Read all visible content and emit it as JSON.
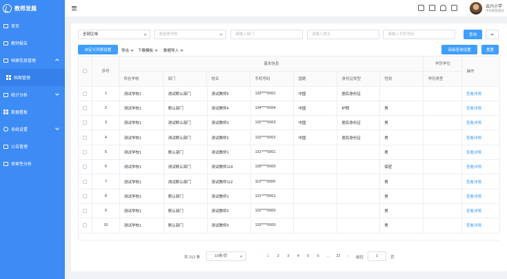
{
  "app": {
    "title": "教师发展"
  },
  "sidebar": {
    "items": [
      {
        "label": "首页"
      },
      {
        "label": "教师报告"
      },
      {
        "label": "档案信息管理"
      },
      {
        "label": "档案管理"
      },
      {
        "label": "统计分析"
      },
      {
        "label": "数据看板"
      },
      {
        "label": "系统设置"
      },
      {
        "label": "公告管理"
      },
      {
        "label": "探索性分析"
      }
    ]
  },
  "header": {
    "user_name": "云兴小学",
    "user_sub": "市校教管理员"
  },
  "filters": {
    "region": "全部区域",
    "school_placeholder": "请选择学校",
    "dept_placeholder": "请输入部门",
    "name_placeholder": "请输入姓名",
    "phone_placeholder": "请输入手机号码",
    "query_label": "查询"
  },
  "toolbar": {
    "custom_cols": "自定义列表设置",
    "export": "导出",
    "download_template": "下载模板",
    "data_import": "数据导入",
    "advanced_query": "高级查询设置",
    "reset": "重置"
  },
  "table": {
    "group_basic": "基本信息",
    "group_edu": "学历学位",
    "col_index": "序号",
    "col_action": "操作",
    "columns": [
      "所在学校",
      "部门",
      "姓名",
      "手机号码",
      "国籍",
      "身份证类型",
      "性别",
      "学历类型"
    ],
    "action_label": "查看详情",
    "rows": [
      {
        "idx": "1",
        "school": "测试学校1",
        "dept": "测试默认部门",
        "name": "测试教师5",
        "phone": "133****0001",
        "nation": "中国",
        "idtype": "居民身份证",
        "gender": ""
      },
      {
        "idx": "2",
        "school": "测试学校1",
        "dept": "默认部门",
        "name": "测试教师4",
        "phone": "134****0004",
        "nation": "中国",
        "idtype": "护照",
        "gender": "男"
      },
      {
        "idx": "3",
        "school": "测试学校1",
        "dept": "测试默认部门",
        "name": "测试教师3",
        "phone": "132****0003",
        "nation": "中国",
        "idtype": "居民身份证",
        "gender": "男"
      },
      {
        "idx": "4",
        "school": "测试学校1",
        "dept": "测试默认部门",
        "name": "测试教师2",
        "phone": "132****0002",
        "nation": "中国",
        "idtype": "居民身份证",
        "gender": "男"
      },
      {
        "idx": "5",
        "school": "测试学校1",
        "dept": "默认部门",
        "name": "测试教师1",
        "phone": "131****0001",
        "nation": "",
        "idtype": "",
        "gender": "男"
      },
      {
        "idx": "6",
        "school": "测试学校1",
        "dept": "测试默认部门",
        "name": "测试教师114",
        "phone": "139****0000",
        "nation": "",
        "idtype": "",
        "gender": "保密"
      },
      {
        "idx": "7",
        "school": "测试学校1",
        "dept": "测试默认部门",
        "name": "测试教师112",
        "phone": "113****0000",
        "nation": "",
        "idtype": "",
        "gender": "男"
      },
      {
        "idx": "8",
        "school": "测试学校1",
        "dept": "默认部门",
        "name": "测试教师1",
        "phone": "131****0001",
        "nation": "",
        "idtype": "",
        "gender": "男"
      },
      {
        "idx": "9",
        "school": "测试学校1",
        "dept": "默认部门",
        "name": "测试教师2",
        "phone": "132****0000",
        "nation": "",
        "idtype": "",
        "gender": "男"
      },
      {
        "idx": "10",
        "school": "测试学校1",
        "dept": "默认部门",
        "name": "测试教师3",
        "phone": "133****0000",
        "nation": "",
        "idtype": "",
        "gender": "男"
      }
    ]
  },
  "pagination": {
    "total": "共 212 条",
    "page_size": "10条/页",
    "pages": [
      "1",
      "2",
      "3",
      "4",
      "5",
      "6",
      "…",
      "22"
    ],
    "goto_label": "前往",
    "goto_value": "1",
    "goto_unit": "页"
  }
}
